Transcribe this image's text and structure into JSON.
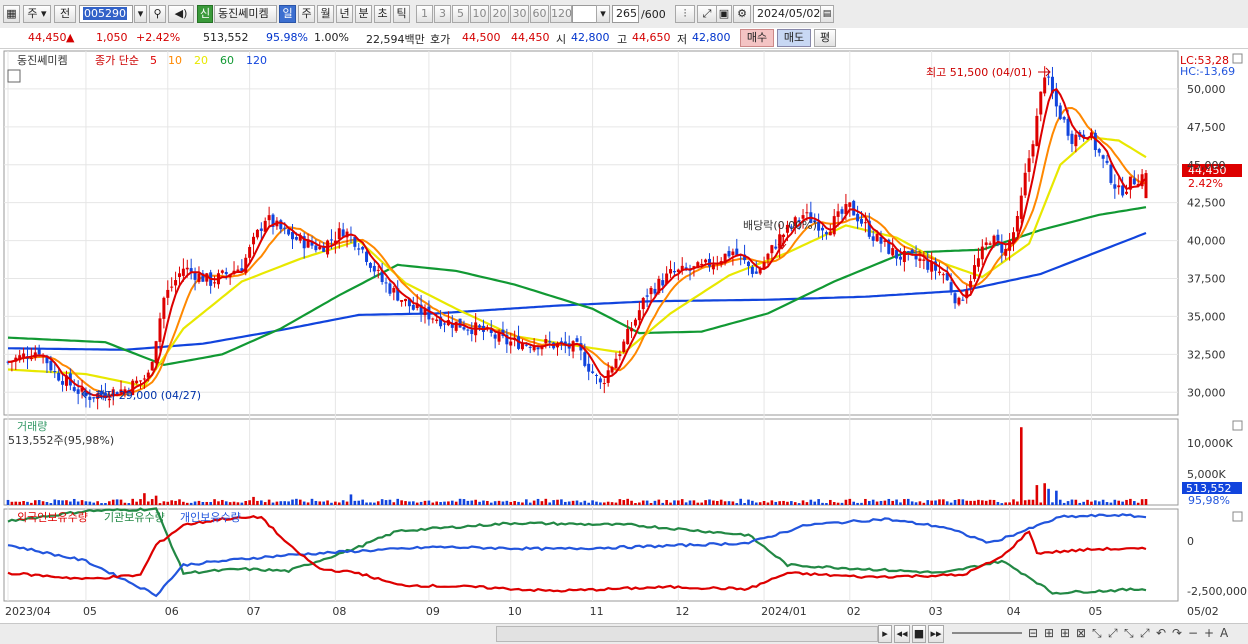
{
  "toolbar": {
    "period_label": "주",
    "prev_label": "전",
    "code": "005290",
    "new_badge": "신",
    "stock_name": "동진쎄미켐",
    "periods": [
      "일",
      "주",
      "월",
      "년",
      "분",
      "초",
      "틱"
    ],
    "minutes": [
      "1",
      "3",
      "5",
      "10",
      "20",
      "30",
      "60",
      "120"
    ],
    "count": "265",
    "count_max": "/600",
    "date": "2024/05/02"
  },
  "info": {
    "price": "44,450",
    "arrow": "▲",
    "change": "1,050",
    "change_pct": "+2.42%",
    "volume": "513,552",
    "volume_ratio": "95.98%",
    "turnover_ratio": "1.00%",
    "amount": "22,594백만",
    "bid_label": "호가",
    "ask_price": "44,500",
    "bid_price": "44,450",
    "open_label": "시",
    "open": "42,800",
    "high_label": "고",
    "high": "44,650",
    "low_label": "저",
    "low": "42,800",
    "buy_btn": "매수",
    "sell_btn": "매도",
    "eval_btn": "평"
  },
  "chart_data": [
    {
      "type": "candlestick",
      "title": "동진쎄미켐",
      "legend": {
        "prefix": "종가 단순",
        "periods": [
          "5",
          "10",
          "20",
          "60",
          "120"
        ],
        "colors": [
          "#dd0000",
          "#ff8800",
          "#e8e800",
          "#119933",
          "#1144dd"
        ]
      },
      "ylim": [
        28500,
        52500
      ],
      "yticks": [
        "50,000",
        "47,500",
        "45,000",
        "42,500",
        "40,000",
        "37,500",
        "35,000",
        "32,500",
        "30,000"
      ],
      "ytick_values": [
        50000,
        47500,
        45000,
        42500,
        40000,
        37500,
        35000,
        32500,
        30000
      ],
      "last_price_label": "44,450",
      "last_pct_label": "2.42%",
      "last_price": 44450,
      "lc_label": "LC:53,28",
      "hc_label": "HC:-13,69",
      "annotations": {
        "high": "최고 51,500 (04/01)",
        "low": "최저 29,000 (04/27)",
        "dividend": "배당락(0.00%)"
      },
      "anchors": [
        {
          "i": 0,
          "p": 32000
        },
        {
          "i": 8,
          "p": 32800
        },
        {
          "i": 12,
          "p": 31300
        },
        {
          "i": 20,
          "p": 29700
        },
        {
          "i": 30,
          "p": 30200
        },
        {
          "i": 36,
          "p": 31100
        },
        {
          "i": 40,
          "p": 36200
        },
        {
          "i": 45,
          "p": 38200
        },
        {
          "i": 52,
          "p": 37300
        },
        {
          "i": 60,
          "p": 38300
        },
        {
          "i": 66,
          "p": 41500
        },
        {
          "i": 72,
          "p": 40300
        },
        {
          "i": 80,
          "p": 39500
        },
        {
          "i": 86,
          "p": 40700
        },
        {
          "i": 90,
          "p": 39800
        },
        {
          "i": 96,
          "p": 37300
        },
        {
          "i": 104,
          "p": 35500
        },
        {
          "i": 112,
          "p": 34700
        },
        {
          "i": 120,
          "p": 34200
        },
        {
          "i": 128,
          "p": 33300
        },
        {
          "i": 138,
          "p": 33200
        },
        {
          "i": 146,
          "p": 32900
        },
        {
          "i": 152,
          "p": 30500
        },
        {
          "i": 158,
          "p": 33200
        },
        {
          "i": 164,
          "p": 36500
        },
        {
          "i": 170,
          "p": 37800
        },
        {
          "i": 178,
          "p": 38200
        },
        {
          "i": 186,
          "p": 39300
        },
        {
          "i": 192,
          "p": 37800
        },
        {
          "i": 198,
          "p": 40200
        },
        {
          "i": 204,
          "p": 41700
        },
        {
          "i": 210,
          "p": 40800
        },
        {
          "i": 216,
          "p": 42200
        },
        {
          "i": 222,
          "p": 40300
        },
        {
          "i": 228,
          "p": 39000
        },
        {
          "i": 234,
          "p": 38700
        },
        {
          "i": 240,
          "p": 37800
        },
        {
          "i": 244,
          "p": 35800
        },
        {
          "i": 248,
          "p": 38200
        },
        {
          "i": 252,
          "p": 40200
        },
        {
          "i": 256,
          "p": 39300
        },
        {
          "i": 259,
          "p": 41200
        },
        {
          "i": 261,
          "p": 44200
        },
        {
          "i": 264,
          "p": 48000
        },
        {
          "i": 266,
          "p": 51100
        },
        {
          "i": 269,
          "p": 48800
        },
        {
          "i": 273,
          "p": 46800
        },
        {
          "i": 277,
          "p": 47200
        },
        {
          "i": 281,
          "p": 45200
        },
        {
          "i": 285,
          "p": 43200
        },
        {
          "i": 289,
          "p": 44000
        },
        {
          "i": 292,
          "p": 44450
        }
      ],
      "ma_anchors": {
        "ma20": [
          {
            "i": 0,
            "p": 31500
          },
          {
            "i": 20,
            "p": 31200
          },
          {
            "i": 35,
            "p": 30400
          },
          {
            "i": 45,
            "p": 34200
          },
          {
            "i": 60,
            "p": 37300
          },
          {
            "i": 75,
            "p": 38800
          },
          {
            "i": 90,
            "p": 40000
          },
          {
            "i": 102,
            "p": 37200
          },
          {
            "i": 115,
            "p": 35500
          },
          {
            "i": 130,
            "p": 33700
          },
          {
            "i": 145,
            "p": 33100
          },
          {
            "i": 158,
            "p": 32600
          },
          {
            "i": 170,
            "p": 35200
          },
          {
            "i": 185,
            "p": 37700
          },
          {
            "i": 200,
            "p": 39200
          },
          {
            "i": 215,
            "p": 41000
          },
          {
            "i": 228,
            "p": 40200
          },
          {
            "i": 240,
            "p": 38500
          },
          {
            "i": 250,
            "p": 37600
          },
          {
            "i": 262,
            "p": 39800
          },
          {
            "i": 270,
            "p": 45000
          },
          {
            "i": 278,
            "p": 46800
          },
          {
            "i": 285,
            "p": 46600
          },
          {
            "i": 292,
            "p": 45500
          }
        ],
        "ma60": [
          {
            "i": 0,
            "p": 33600
          },
          {
            "i": 25,
            "p": 33300
          },
          {
            "i": 40,
            "p": 31800
          },
          {
            "i": 55,
            "p": 32500
          },
          {
            "i": 70,
            "p": 34200
          },
          {
            "i": 85,
            "p": 36400
          },
          {
            "i": 100,
            "p": 38400
          },
          {
            "i": 115,
            "p": 38000
          },
          {
            "i": 130,
            "p": 37100
          },
          {
            "i": 150,
            "p": 35500
          },
          {
            "i": 162,
            "p": 33900
          },
          {
            "i": 178,
            "p": 34000
          },
          {
            "i": 195,
            "p": 35200
          },
          {
            "i": 212,
            "p": 37300
          },
          {
            "i": 230,
            "p": 39200
          },
          {
            "i": 250,
            "p": 39400
          },
          {
            "i": 265,
            "p": 40700
          },
          {
            "i": 280,
            "p": 41700
          },
          {
            "i": 292,
            "p": 42200
          }
        ],
        "ma120": [
          {
            "i": 0,
            "p": 32900
          },
          {
            "i": 30,
            "p": 32800
          },
          {
            "i": 50,
            "p": 33200
          },
          {
            "i": 70,
            "p": 34100
          },
          {
            "i": 90,
            "p": 35100
          },
          {
            "i": 110,
            "p": 35200
          },
          {
            "i": 140,
            "p": 35700
          },
          {
            "i": 165,
            "p": 36000
          },
          {
            "i": 195,
            "p": 36100
          },
          {
            "i": 220,
            "p": 36300
          },
          {
            "i": 245,
            "p": 36700
          },
          {
            "i": 265,
            "p": 37800
          },
          {
            "i": 280,
            "p": 39300
          },
          {
            "i": 292,
            "p": 40500
          }
        ]
      }
    },
    {
      "type": "bar",
      "title": "거래량",
      "subtitle": "513,552주(95,98%)",
      "yticks": [
        "10,000K",
        "5,000K"
      ],
      "ytick_values": [
        10000,
        5000
      ],
      "last_label": "513,552",
      "last_pct_label": "95,98%",
      "spikes": [
        {
          "i": 35,
          "v": 1900
        },
        {
          "i": 38,
          "v": 1500
        },
        {
          "i": 63,
          "v": 1300
        },
        {
          "i": 88,
          "v": 1700
        },
        {
          "i": 260,
          "v": 12500
        },
        {
          "i": 264,
          "v": 3200
        },
        {
          "i": 266,
          "v": 3500
        },
        {
          "i": 267,
          "v": 2600
        },
        {
          "i": 269,
          "v": 2300
        }
      ]
    },
    {
      "type": "line",
      "title": "외국인보유수량",
      "series_names": [
        "외국인보유수량",
        "기관보유수량",
        "개인보유수량"
      ],
      "series_colors": [
        "#dd0000",
        "#228844",
        "#2255dd"
      ],
      "yticks": [
        "0",
        "-2,500,000"
      ],
      "ytick_values": [
        0,
        -2500000
      ],
      "foreign": [
        {
          "i": 0,
          "p": -1600000
        },
        {
          "i": 20,
          "p": -1900000
        },
        {
          "i": 34,
          "p": -1700000
        },
        {
          "i": 38,
          "p": -200000
        },
        {
          "i": 45,
          "p": 800000
        },
        {
          "i": 55,
          "p": 1100000
        },
        {
          "i": 65,
          "p": 1200000
        },
        {
          "i": 72,
          "p": -200000
        },
        {
          "i": 80,
          "p": -1400000
        },
        {
          "i": 90,
          "p": -1600000
        },
        {
          "i": 100,
          "p": -2200000
        },
        {
          "i": 120,
          "p": -2300000
        },
        {
          "i": 140,
          "p": -2500000
        },
        {
          "i": 170,
          "p": -2300000
        },
        {
          "i": 190,
          "p": -2400000
        },
        {
          "i": 200,
          "p": -1600000
        },
        {
          "i": 220,
          "p": -1800000
        },
        {
          "i": 245,
          "p": -1700000
        },
        {
          "i": 255,
          "p": -800000
        },
        {
          "i": 262,
          "p": 500000
        },
        {
          "i": 264,
          "p": -600000
        },
        {
          "i": 280,
          "p": -400000
        },
        {
          "i": 292,
          "p": -400000
        }
      ],
      "institution": [
        {
          "i": 0,
          "p": 1000000
        },
        {
          "i": 20,
          "p": 1500000
        },
        {
          "i": 38,
          "p": 1600000
        },
        {
          "i": 45,
          "p": -1600000
        },
        {
          "i": 60,
          "p": -1400000
        },
        {
          "i": 72,
          "p": -1500000
        },
        {
          "i": 90,
          "p": -300000
        },
        {
          "i": 100,
          "p": 500000
        },
        {
          "i": 130,
          "p": 900000
        },
        {
          "i": 160,
          "p": 800000
        },
        {
          "i": 190,
          "p": 300000
        },
        {
          "i": 200,
          "p": -1200000
        },
        {
          "i": 220,
          "p": -1400000
        },
        {
          "i": 240,
          "p": -1600000
        },
        {
          "i": 255,
          "p": -1000000
        },
        {
          "i": 262,
          "p": -1800000
        },
        {
          "i": 268,
          "p": -2600000
        },
        {
          "i": 280,
          "p": -2500000
        },
        {
          "i": 292,
          "p": -2400000
        }
      ],
      "individual": [
        {
          "i": 0,
          "p": -200000
        },
        {
          "i": 20,
          "p": -1000000
        },
        {
          "i": 38,
          "p": -2700000
        },
        {
          "i": 45,
          "p": -1200000
        },
        {
          "i": 60,
          "p": -900000
        },
        {
          "i": 72,
          "p": -700000
        },
        {
          "i": 90,
          "p": -500000
        },
        {
          "i": 110,
          "p": -300000
        },
        {
          "i": 140,
          "p": -400000
        },
        {
          "i": 160,
          "p": -300000
        },
        {
          "i": 190,
          "p": -100000
        },
        {
          "i": 205,
          "p": 800000
        },
        {
          "i": 225,
          "p": 1100000
        },
        {
          "i": 240,
          "p": 700000
        },
        {
          "i": 252,
          "p": -100000
        },
        {
          "i": 262,
          "p": 600000
        },
        {
          "i": 270,
          "p": 1200000
        },
        {
          "i": 285,
          "p": 1300000
        },
        {
          "i": 292,
          "p": 1200000
        }
      ],
      "x_labels": [
        "2023/04",
        "05",
        "06",
        "07",
        "08",
        "09",
        "10",
        "11",
        "12",
        "2024/01",
        "02",
        "03",
        "04",
        "05"
      ],
      "x_label_idx": [
        0,
        20,
        41,
        62,
        84,
        108,
        129,
        150,
        172,
        194,
        216,
        237,
        257,
        278
      ],
      "right_x_label": "05/02"
    }
  ],
  "navbar": {
    "label": "navigation"
  }
}
